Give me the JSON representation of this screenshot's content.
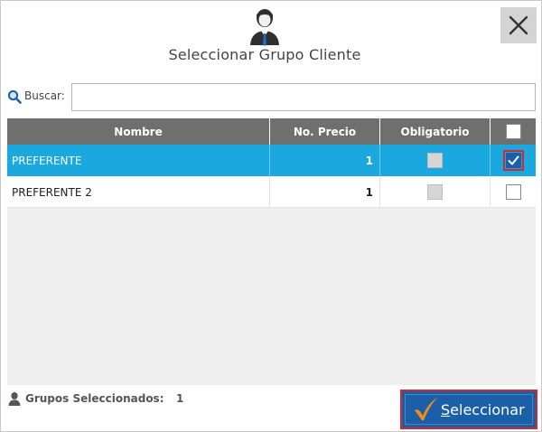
{
  "dialog": {
    "title": "Seleccionar Grupo Cliente",
    "header_icon": "user-icon",
    "close_icon": "close-icon"
  },
  "search": {
    "icon": "search-icon",
    "label": "Buscar:",
    "value": "",
    "placeholder": ""
  },
  "grid": {
    "columns": [
      "Nombre",
      "No. Precio",
      "Obligatorio",
      ""
    ],
    "rows": [
      {
        "nombre": "PREFERENTE",
        "no_precio": "1",
        "obligatorio": false,
        "selected": true
      },
      {
        "nombre": "PREFERENTE 2",
        "no_precio": "1",
        "obligatorio": false,
        "selected": false
      }
    ],
    "select_all_checked": false
  },
  "footer": {
    "icon": "user-icon",
    "label": "Grupos Seleccionados:",
    "count": "1"
  },
  "select_button": {
    "icon": "checkmark-icon",
    "underlined": "S",
    "label_rest": "eleccionar"
  },
  "colors": {
    "selected_row": "#1aa8df",
    "header_bg": "#6f6f6f",
    "button_bg": "#1a5fa8",
    "focus_border": "#d9262b",
    "check_orange": "#f28a1c"
  }
}
